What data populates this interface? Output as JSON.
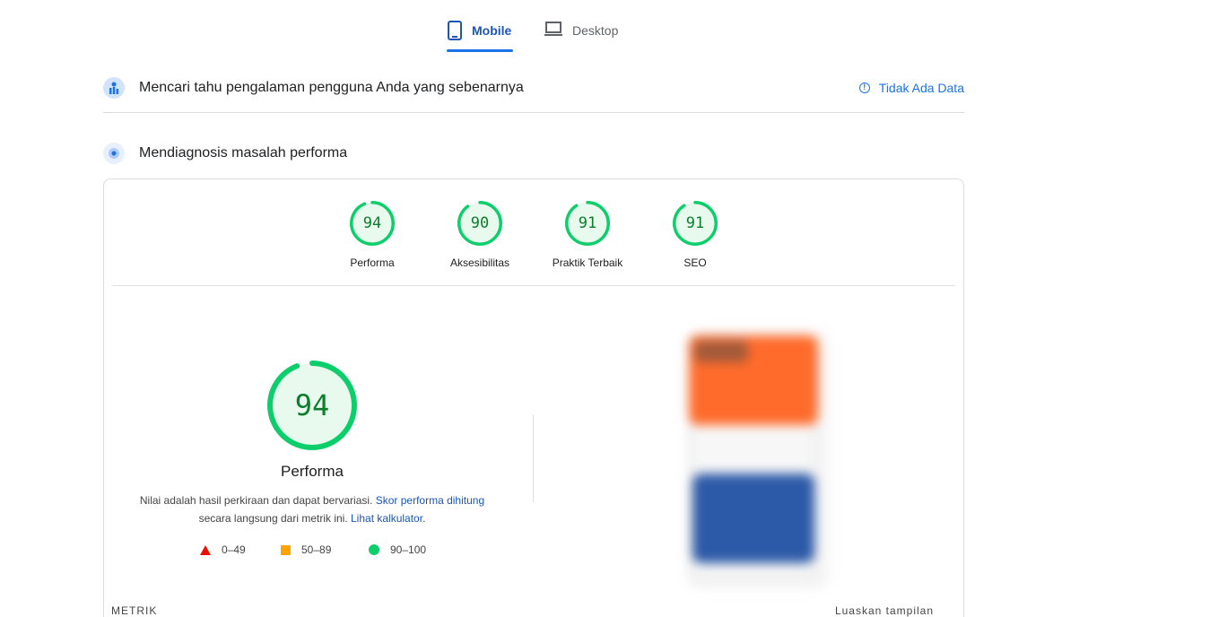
{
  "tabs": {
    "mobile": "Mobile",
    "desktop": "Desktop"
  },
  "field_data": {
    "title": "Mencari tahu pengalaman pengguna Anda yang sebenarnya",
    "no_data": "Tidak Ada Data"
  },
  "diagnose": {
    "title": "Mendiagnosis masalah performa"
  },
  "categories": [
    {
      "label": "Performa",
      "score": "94",
      "value": 94
    },
    {
      "label": "Aksesibilitas",
      "score": "90",
      "value": 90
    },
    {
      "label": "Praktik Terbaik",
      "score": "91",
      "value": 91
    },
    {
      "label": "SEO",
      "score": "91",
      "value": 91
    }
  ],
  "performance": {
    "score": "94",
    "value": 94,
    "title": "Performa",
    "desc_text": "Nilai adalah hasil perkiraan dan dapat bervariasi.",
    "desc_link1": "Skor performa dihitung",
    "desc_middle": "secara langsung dari metrik ini.",
    "desc_link2": "Lihat kalkulator",
    "desc_end": "."
  },
  "legend": {
    "poor": "0–49",
    "average": "50–89",
    "good": "90–100"
  },
  "footer": {
    "metrics": "METRIK",
    "expand": "Luaskan tampilan"
  },
  "colors": {
    "accent": "#1a73e8",
    "good": "#0cce6b",
    "good_text": "#0d7d2c",
    "average": "#ffa400",
    "poor": "#eb0f00"
  }
}
